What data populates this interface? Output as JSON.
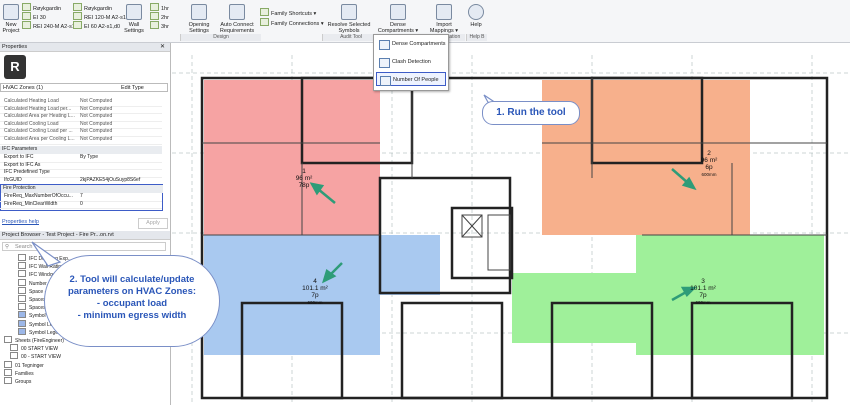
{
  "ribbon": {
    "new_project": "New Project",
    "family_items": [
      "Røykgardin",
      "EI 30",
      "REI 240-M A2-s1..."
    ],
    "family_items2": [
      "Røykgardin",
      "REI 120-M A2-s1",
      "EI 60 A2-s1,d0"
    ],
    "wall_settings": "Wall Settings",
    "stairs": [
      "1hr",
      "2hr",
      "3hr"
    ],
    "opening_settings": "Opening Settings",
    "auto_connect": "Auto Connect Requirements",
    "family_shortcuts": "Family Shortcuts",
    "family_connections": "Family Connections",
    "resolve": "Resolve Selected Symbols",
    "dense": "Dense Compartments",
    "import": "Import Mappings",
    "help": "Help",
    "groups": [
      "Design",
      "Audit Tool",
      "ication",
      "Help B"
    ]
  },
  "dropdown": {
    "items": [
      "Dense Compartments",
      "Clash Detection",
      "Number Of People"
    ]
  },
  "properties": {
    "title": "Properties",
    "type_selector": "HVAC Zones (1)",
    "edit_type": "Edit Type",
    "rows1": [
      {
        "k": "Calculated Heating Load",
        "v": "Not Computed"
      },
      {
        "k": "Calculated Heating Load per...",
        "v": "Not Computed"
      },
      {
        "k": "Calculated Area per Heating L...",
        "v": "Not Computed"
      },
      {
        "k": "Calculated Cooling Load",
        "v": "Not Computed"
      },
      {
        "k": "Calculated Cooling Load per ...",
        "v": "Not Computed"
      },
      {
        "k": "Calculated Area per Cooling L...",
        "v": "Not Computed"
      }
    ],
    "ifc_section": "IFC Parameters",
    "rows2": [
      {
        "k": "Export to IFC",
        "v": "By Type"
      },
      {
        "k": "Export to IFC As",
        "v": ""
      },
      {
        "k": "IFC Predefined Type",
        "v": ""
      },
      {
        "k": "IfcGUID",
        "v": "2kjPAZKE54jOuSuyp8S6ef"
      }
    ],
    "fire_section": "Fire Protection",
    "rows3": [
      {
        "k": "FireReq_MaxNumberOfOccu...",
        "v": "7"
      },
      {
        "k": "FireReq_MinClearWidth",
        "v": "0"
      }
    ],
    "help_link": "Properties help",
    "apply": "Apply"
  },
  "browser": {
    "title": "Project Browser - Test Project - Fire Pr...on.rvt",
    "search_placeholder": "Search",
    "items": [
      "IFC Door req Exp...",
      "IFC Wall Rating...",
      "IFC Window...",
      "Number...",
      "Space -...",
      "Spaces -...",
      "Spaces -...",
      "Symbol Legend...",
      "Symbol Legend...",
      "Symbol Legend",
      "Sheets (FireEngineer)",
      "00 START VIEW",
      "00 - START VIEW",
      "01 Tegninger",
      "Families",
      "Groups"
    ]
  },
  "zones": [
    {
      "id": "1",
      "area": "96 m²",
      "people": "78p",
      "width": ""
    },
    {
      "id": "2",
      "area": "96 m²",
      "people": "6p",
      "width": "600mm"
    },
    {
      "id": "4",
      "area": "101.1 m²",
      "people": "7p",
      "width": "600mm"
    },
    {
      "id": "3",
      "area": "101.1 m²",
      "people": "7p",
      "width": "600mm"
    }
  ],
  "callouts": {
    "run_tool": "1. Run the tool",
    "tool_desc_1": "2. Tool will calculate/update",
    "tool_desc_2": "parameters on HVAC Zones:",
    "tool_desc_3": "- occupant load",
    "tool_desc_4": "- minimum egress width"
  },
  "colors": {
    "zone_red": "#f6a3a3",
    "zone_orange": "#f7b08c",
    "zone_blue": "#a9c9f0",
    "zone_green": "#9ff09a",
    "arrow": "#2e9c78",
    "callout_text": "#2a56b8"
  }
}
